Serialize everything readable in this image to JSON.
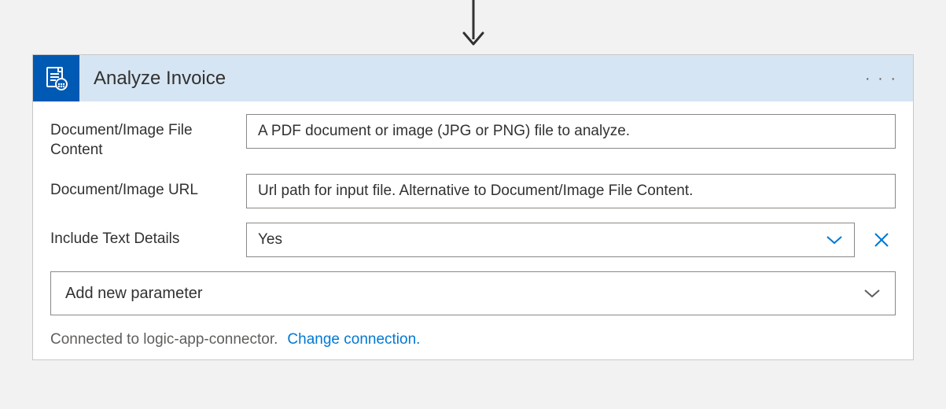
{
  "action": {
    "title": "Analyze Invoice",
    "fields": {
      "file_content": {
        "label": "Document/Image File Content",
        "placeholder": "A PDF document or image (JPG or PNG) file to analyze."
      },
      "url": {
        "label": "Document/Image URL",
        "placeholder": "Url path for input file. Alternative to Document/Image File Content."
      },
      "include_text": {
        "label": "Include Text Details",
        "value": "Yes"
      }
    },
    "add_param": "Add new parameter",
    "footer": {
      "connected": "Connected to logic-app-connector.",
      "change": "Change connection."
    }
  }
}
